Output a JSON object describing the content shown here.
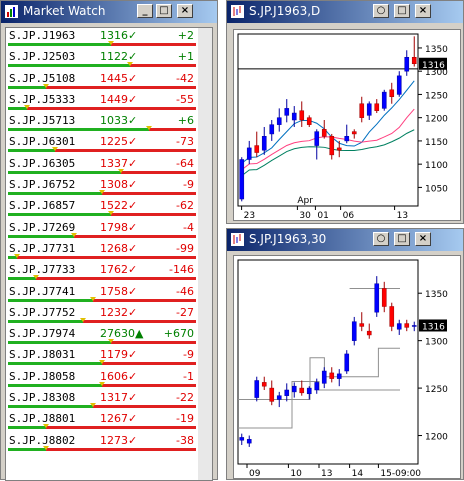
{
  "market_watch": {
    "title": "Market Watch",
    "rows": [
      {
        "symbol": "S.JP.J1963",
        "price": "1316✓",
        "change": "+2",
        "up": true
      },
      {
        "symbol": "S.JP.J2503",
        "price": "1122✓",
        "change": "+1",
        "up": true
      },
      {
        "symbol": "S.JP.J5108",
        "price": "1445✓",
        "change": "-42",
        "up": false
      },
      {
        "symbol": "S.JP.J5333",
        "price": "1449✓",
        "change": "-55",
        "up": false
      },
      {
        "symbol": "S.JP.J5713",
        "price": "1033✓",
        "change": "+6",
        "up": true
      },
      {
        "symbol": "S.JP.J6301",
        "price": "1225✓",
        "change": "-73",
        "up": false
      },
      {
        "symbol": "S.JP.J6305",
        "price": "1337✓",
        "change": "-64",
        "up": false
      },
      {
        "symbol": "S.JP.J6752",
        "price": "1308✓",
        "change": "-9",
        "up": false
      },
      {
        "symbol": "S.JP.J6857",
        "price": "1522✓",
        "change": "-62",
        "up": false
      },
      {
        "symbol": "S.JP.J7269",
        "price": "1798✓",
        "change": "-4",
        "up": false
      },
      {
        "symbol": "S.JP.J7731",
        "price": "1268✓",
        "change": "-99",
        "up": false
      },
      {
        "symbol": "S.JP.J7733",
        "price": "1762✓",
        "change": "-146",
        "up": false
      },
      {
        "symbol": "S.JP.J7741",
        "price": "1758✓",
        "change": "-46",
        "up": false
      },
      {
        "symbol": "S.JP.J7752",
        "price": "1232✓",
        "change": "-27",
        "up": false
      },
      {
        "symbol": "S.JP.J7974",
        "price": "27630▲",
        "change": "+670",
        "up": true
      },
      {
        "symbol": "S.JP.J8031",
        "price": "1179✓",
        "change": "-9",
        "up": false
      },
      {
        "symbol": "S.JP.J8058",
        "price": "1606✓",
        "change": "-1",
        "up": false
      },
      {
        "symbol": "S.JP.J8308",
        "price": "1317✓",
        "change": "-22",
        "up": false
      },
      {
        "symbol": "S.JP.J8801",
        "price": "1267✓",
        "change": "-19",
        "up": false
      },
      {
        "symbol": "S.JP.J8802",
        "price": "1273✓",
        "change": "-38",
        "up": false
      }
    ],
    "bar_fraction": [
      0.55,
      0.65,
      0.2,
      0.1,
      0.75,
      0.25,
      0.6,
      0.5,
      0.55,
      0.35,
      0.05,
      0.15,
      0.45,
      0.4,
      0.55,
      0.5,
      0.5,
      0.45,
      0.2,
      0.2
    ]
  },
  "chart_daily": {
    "title": "S.JP.J1963,D",
    "price_label": "1316",
    "yticks": [
      "1350",
      "1300",
      "1250",
      "1200",
      "1150",
      "1100",
      "1050"
    ],
    "xticks": [
      "23",
      "30",
      "01",
      "06",
      "13"
    ],
    "month_label": "Apr"
  },
  "chart_30m": {
    "title": "S.JP.J1963,30",
    "price_label": "1316",
    "yticks": [
      "1350",
      "1300",
      "1250",
      "1200"
    ],
    "xticks": [
      "09",
      "10",
      "13",
      "14",
      "15-09:00"
    ]
  },
  "chart_data": [
    {
      "type": "candlestick",
      "title": "S.JP.J1963,D",
      "ylim": [
        1010,
        1380
      ],
      "candles": [
        [
          1025,
          1115,
          1020,
          1110
        ],
        [
          1110,
          1150,
          1100,
          1135
        ],
        [
          1140,
          1170,
          1115,
          1125
        ],
        [
          1130,
          1180,
          1120,
          1160
        ],
        [
          1165,
          1195,
          1150,
          1185
        ],
        [
          1185,
          1220,
          1170,
          1200
        ],
        [
          1205,
          1240,
          1190,
          1220
        ],
        [
          1195,
          1225,
          1180,
          1210
        ],
        [
          1215,
          1235,
          1180,
          1195
        ],
        [
          1200,
          1205,
          1180,
          1185
        ],
        [
          1140,
          1175,
          1110,
          1170
        ],
        [
          1175,
          1195,
          1155,
          1160
        ],
        [
          1160,
          1165,
          1110,
          1120
        ],
        [
          1135,
          1150,
          1115,
          1130
        ],
        [
          1150,
          1185,
          1145,
          1160
        ],
        [
          1170,
          1175,
          1155,
          1165
        ],
        [
          1230,
          1245,
          1190,
          1200
        ],
        [
          1205,
          1235,
          1195,
          1230
        ],
        [
          1230,
          1240,
          1210,
          1215
        ],
        [
          1220,
          1260,
          1215,
          1255
        ],
        [
          1260,
          1275,
          1230,
          1245
        ],
        [
          1250,
          1300,
          1245,
          1290
        ],
        [
          1300,
          1345,
          1290,
          1330
        ],
        [
          1330,
          1375,
          1310,
          1316
        ]
      ],
      "hline": 1305
    },
    {
      "type": "candlestick",
      "title": "S.JP.J1963,30",
      "ylim": [
        1170,
        1385
      ],
      "candles": [
        [
          1195,
          1202,
          1190,
          1198
        ],
        [
          1192,
          1200,
          1188,
          1196
        ],
        [
          1240,
          1262,
          1236,
          1258
        ],
        [
          1256,
          1262,
          1248,
          1252
        ],
        [
          1250,
          1258,
          1232,
          1236
        ],
        [
          1238,
          1246,
          1230,
          1242
        ],
        [
          1242,
          1255,
          1236,
          1248
        ],
        [
          1246,
          1256,
          1240,
          1252
        ],
        [
          1250,
          1258,
          1242,
          1245
        ],
        [
          1244,
          1252,
          1238,
          1250
        ],
        [
          1248,
          1260,
          1244,
          1256
        ],
        [
          1255,
          1272,
          1250,
          1268
        ],
        [
          1266,
          1272,
          1256,
          1260
        ],
        [
          1260,
          1270,
          1252,
          1265
        ],
        [
          1268,
          1290,
          1265,
          1286
        ],
        [
          1300,
          1325,
          1295,
          1320
        ],
        [
          1318,
          1330,
          1310,
          1315
        ],
        [
          1310,
          1318,
          1302,
          1306
        ],
        [
          1330,
          1368,
          1325,
          1360
        ],
        [
          1355,
          1362,
          1330,
          1336
        ],
        [
          1336,
          1340,
          1310,
          1315
        ],
        [
          1312,
          1322,
          1306,
          1318
        ],
        [
          1318,
          1322,
          1310,
          1314
        ],
        [
          1316,
          1320,
          1310,
          1316
        ]
      ]
    }
  ]
}
